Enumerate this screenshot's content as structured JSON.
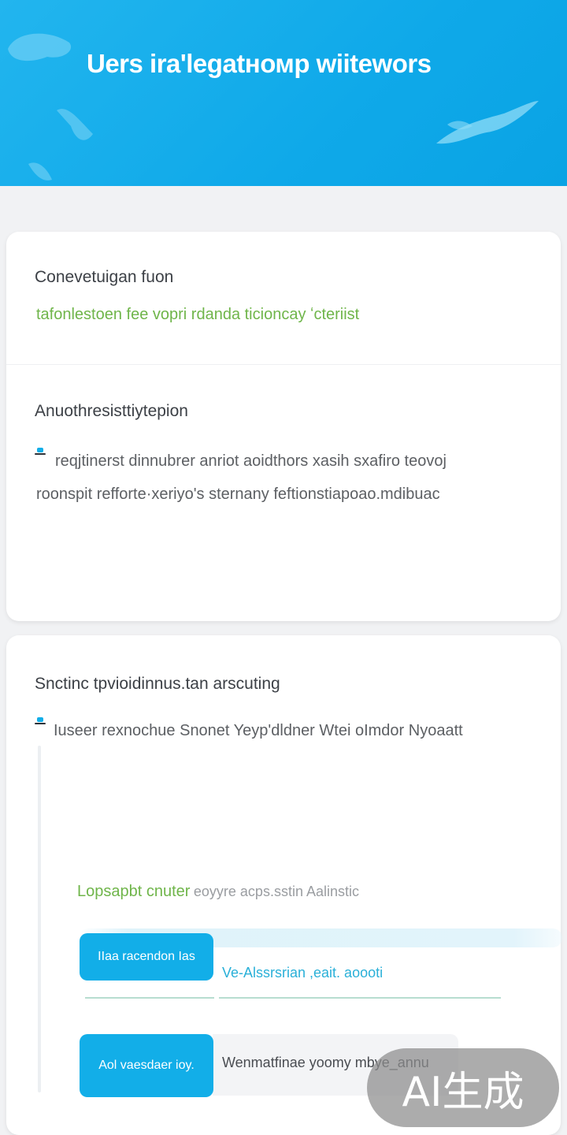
{
  "header": {
    "title": "Uers ira'legatномp wiitewors"
  },
  "card1": {
    "section1_title": "Conevetuigan fuon",
    "section1_link": "tafonlestoen fee vopri rdanda ticioncay ʻcteriist",
    "section2_title": "Anuothresisttiytepion",
    "section2_line1": "reqjtinerst dinnubrer anriot aoidthors xasih sxafiro teovoj",
    "section2_line2": "roonspit refforte·xeriyo's sternany feftionstiapoao.mdibuac"
  },
  "card2": {
    "title": "Snctinc tpvioidinnus.tan arscuting",
    "bullet_line": "Iuseer rexnochue Snonet Yeyp'dldner Wtei oImdor Nyoaatt",
    "green_line": "Lopsapbt cnuter",
    "grey_after_green": "eoyyre acps.sstin Aalinstic",
    "button1_label": "IIaa racendon Ias",
    "row1_text": "Ve-Alssrsrian ,eait. aoooti",
    "button2_label": "Aol vaesdaer ioy.",
    "row2_text": "Wenmatfinae yoomy mbye_annu"
  },
  "watermark": {
    "text": "AI生成"
  },
  "colors": {
    "header_blue": "#12aee8",
    "accent_green": "#6fb54a",
    "button_blue": "#12aee8",
    "link_teal": "#2ab0d8"
  },
  "icons": {
    "bullet": "pin-icon"
  }
}
